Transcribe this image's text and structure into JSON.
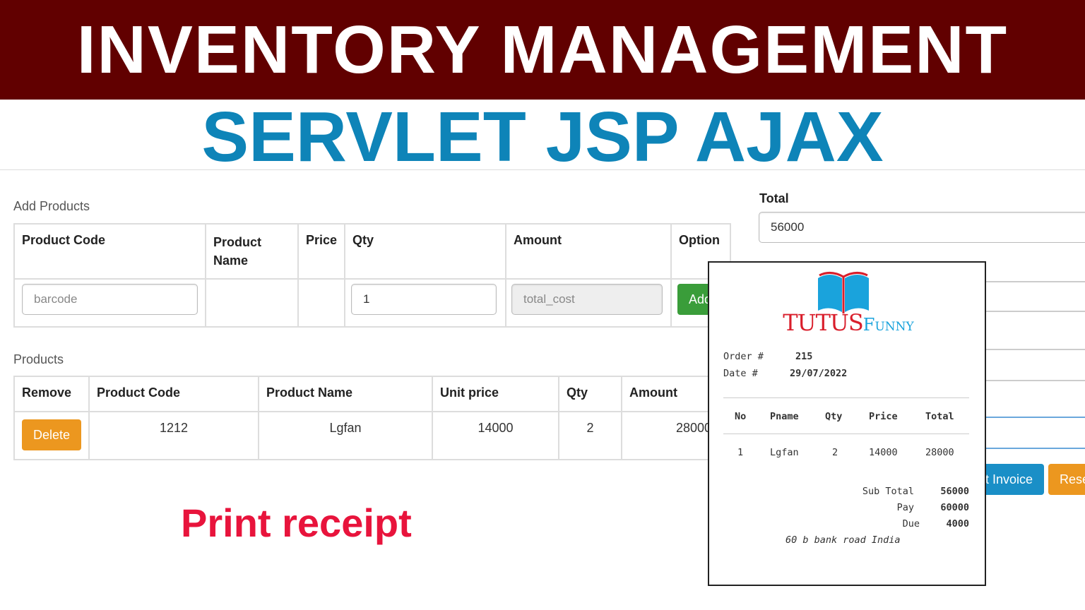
{
  "banner": {
    "title": "INVENTORY MANAGEMENT",
    "subtitle": "SERVLET JSP AJAX"
  },
  "add_products": {
    "heading": "Add Products",
    "columns": [
      "Product Code",
      "Product Name",
      "Price",
      "Qty",
      "Amount",
      "Option"
    ],
    "barcode_placeholder": "barcode",
    "qty_value": "1",
    "amount_placeholder": "total_cost",
    "add_button": "Add"
  },
  "products": {
    "heading": "Products",
    "columns": [
      "Remove",
      "Product Code",
      "Product Name",
      "Unit price",
      "Qty",
      "Amount"
    ],
    "rows": [
      {
        "remove": "Delete",
        "code": "1212",
        "name": "Lgfan",
        "price": "14000",
        "qty": "2",
        "amount": "28000"
      }
    ]
  },
  "totals": {
    "label": "Total",
    "value": "56000",
    "invoice_button": "t Invoice",
    "reset_button": "Reset"
  },
  "receipt": {
    "logo": "TutusFunny",
    "order_label": "Order #",
    "order": "215",
    "date_label": "Date #",
    "date": "29/07/2022",
    "columns": [
      "No",
      "Pname",
      "Qty",
      "Price",
      "Total"
    ],
    "rows": [
      {
        "no": "1",
        "pname": "Lgfan",
        "qty": "2",
        "price": "14000",
        "total": "28000"
      }
    ],
    "subtotal_label": "Sub Total",
    "subtotal": "56000",
    "pay_label": "Pay",
    "pay": "60000",
    "due_label": "Due",
    "due": "4000",
    "address": "60 b bank road India"
  },
  "caption": "Print receipt",
  "colors": {
    "banner": "#610000",
    "subtitle": "#0e84b8",
    "add": "#3a9d3a",
    "delete": "#ec971f",
    "invoice": "#1a8fc7",
    "caption": "#e8143c"
  }
}
